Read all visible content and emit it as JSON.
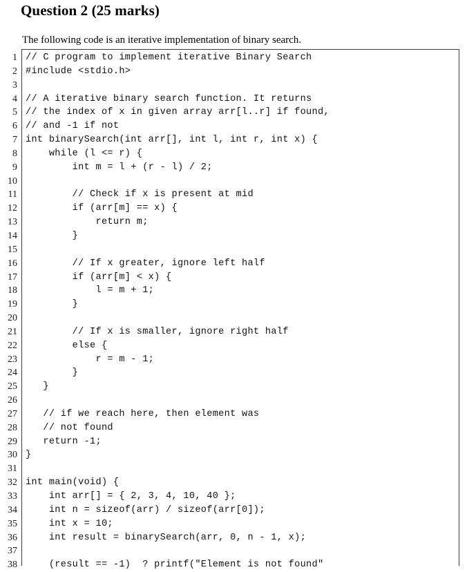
{
  "page": {
    "background_color": "#ffffff",
    "text_color": "#000000"
  },
  "heading": {
    "title": "Question 2 (25 marks)"
  },
  "intro": {
    "text": "The following code is an iterative implementation of binary search."
  },
  "code_listing": {
    "language": "C",
    "border_color": "#3a3a3a",
    "gutter_rule_color": "#3a3a3a",
    "first_line_number": 1,
    "lines": [
      {
        "number": "1",
        "code": "// C program to implement iterative Binary Search"
      },
      {
        "number": "2",
        "code": "#include <stdio.h>"
      },
      {
        "number": "3",
        "code": ""
      },
      {
        "number": "4",
        "code": "// A iterative binary search function. It returns"
      },
      {
        "number": "5",
        "code": "// the index of x in given array arr[l..r] if found,"
      },
      {
        "number": "6",
        "code": "// and -1 if not"
      },
      {
        "number": "7",
        "code": "int binarySearch(int arr[], int l, int r, int x) {"
      },
      {
        "number": "8",
        "code": "    while (l <= r) {"
      },
      {
        "number": "9",
        "code": "        int m = l + (r - l) / 2;"
      },
      {
        "number": "10",
        "code": ""
      },
      {
        "number": "11",
        "code": "        // Check if x is present at mid"
      },
      {
        "number": "12",
        "code": "        if (arr[m] == x) {"
      },
      {
        "number": "13",
        "code": "            return m;"
      },
      {
        "number": "14",
        "code": "        }"
      },
      {
        "number": "15",
        "code": ""
      },
      {
        "number": "16",
        "code": "        // If x greater, ignore left half"
      },
      {
        "number": "17",
        "code": "        if (arr[m] < x) {"
      },
      {
        "number": "18",
        "code": "            l = m + 1;"
      },
      {
        "number": "19",
        "code": "        }"
      },
      {
        "number": "20",
        "code": ""
      },
      {
        "number": "21",
        "code": "        // If x is smaller, ignore right half"
      },
      {
        "number": "22",
        "code": "        else {"
      },
      {
        "number": "23",
        "code": "            r = m - 1;"
      },
      {
        "number": "24",
        "code": "        }"
      },
      {
        "number": "25",
        "code": "   }"
      },
      {
        "number": "26",
        "code": ""
      },
      {
        "number": "27",
        "code": "   // if we reach here, then element was"
      },
      {
        "number": "28",
        "code": "   // not found"
      },
      {
        "number": "29",
        "code": "   return -1;"
      },
      {
        "number": "30",
        "code": "}"
      },
      {
        "number": "31",
        "code": ""
      },
      {
        "number": "32",
        "code": "int main(void) {"
      },
      {
        "number": "33",
        "code": "    int arr[] = { 2, 3, 4, 10, 40 };"
      },
      {
        "number": "34",
        "code": "    int n = sizeof(arr) / sizeof(arr[0]);"
      },
      {
        "number": "35",
        "code": "    int x = 10;"
      },
      {
        "number": "36",
        "code": "    int result = binarySearch(arr, 0, n - 1, x);"
      },
      {
        "number": "37",
        "code": ""
      },
      {
        "number": "38",
        "code": "    (result == -1)  ? printf(\"Element is not found\""
      }
    ]
  }
}
